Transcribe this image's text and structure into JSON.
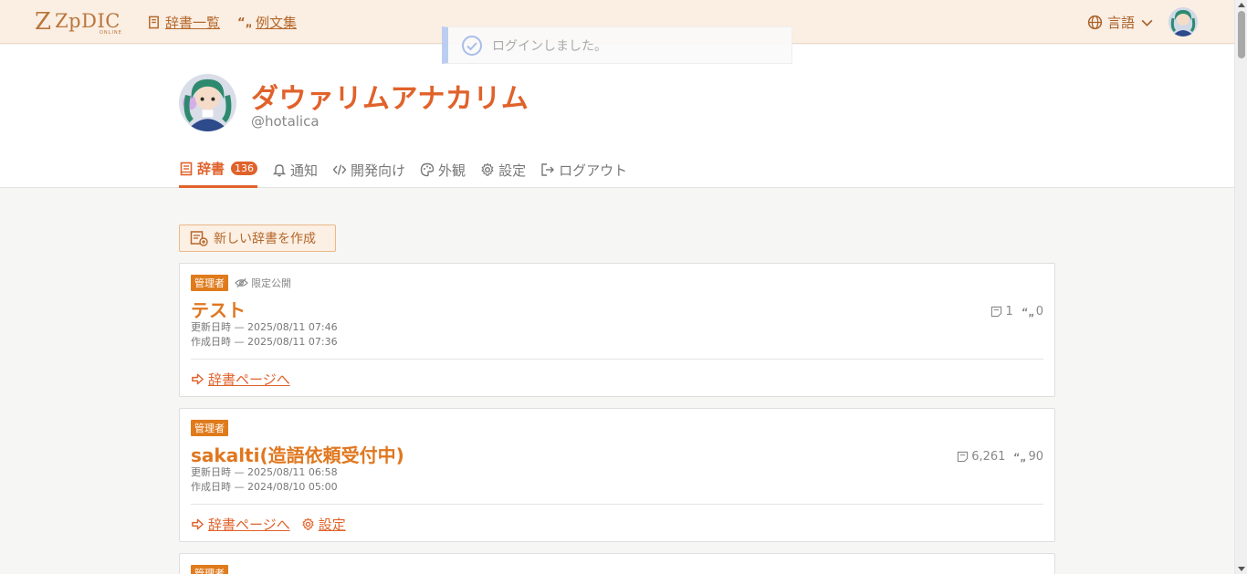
{
  "header": {
    "logo_text": "ZpDIC",
    "logo_sub": "ONLINE",
    "nav": [
      {
        "label": "辞書一覧",
        "icon": "book-icon"
      },
      {
        "label": "例文集",
        "icon": "quote-icon"
      }
    ],
    "language_label": "言語"
  },
  "toast": {
    "message": "ログインしました。"
  },
  "profile": {
    "name": "ダウァリムアナカリム",
    "handle": "@hotalica"
  },
  "tabs": [
    {
      "label": "辞書",
      "badge": "136",
      "active": true,
      "icon": "dictionary-icon"
    },
    {
      "label": "通知",
      "icon": "bell-icon"
    },
    {
      "label": "開発向け",
      "icon": "code-icon"
    },
    {
      "label": "外観",
      "icon": "palette-icon"
    },
    {
      "label": "設定",
      "icon": "gear-icon"
    },
    {
      "label": "ログアウト",
      "icon": "logout-icon"
    }
  ],
  "create_button_label": "新しい辞書を作成",
  "dictionaries": [
    {
      "tag": "管理者",
      "visibility": "限定公開",
      "title": "テスト",
      "updated": "更新日時 — 2025/08/11 07:46",
      "created": "作成日時 — 2025/08/11 07:36",
      "words": "1",
      "examples": "0",
      "actions": [
        "辞書ページへ"
      ]
    },
    {
      "tag": "管理者",
      "title": "sakalti(造語依頼受付中)",
      "updated": "更新日時 — 2025/08/11 06:58",
      "created": "作成日時 — 2024/08/10 05:00",
      "words": "6,261",
      "examples": "90",
      "actions": [
        "辞書ページへ",
        "設定"
      ]
    },
    {
      "tag": "管理者"
    }
  ],
  "colors": {
    "accent": "#e0622b",
    "header_bg": "#fbeee3",
    "tag_bg": "#e07b1c"
  }
}
